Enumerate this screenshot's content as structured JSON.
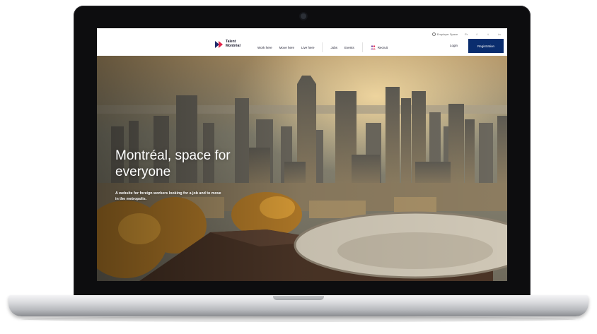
{
  "utility": {
    "employer_space": "Employer Space",
    "language": "Fr",
    "social_icons": [
      "facebook-icon",
      "twitter-icon",
      "linkedin-icon"
    ]
  },
  "brand": {
    "line1": "Talent",
    "line2": "Montréal",
    "colors": {
      "mark_dark": "#1d2a6b",
      "mark_accent": "#e2254a",
      "nav_button": "#0a2d6e"
    }
  },
  "nav": {
    "work_here": "Work here",
    "move_here": "Move here",
    "live_here": "Live here",
    "jobs": "Jobs",
    "events": "Events",
    "recruit": "Recruit",
    "login": "Login",
    "registration": "Registration"
  },
  "hero": {
    "title": "Montréal, space for everyone",
    "subtitle": "A website for foreign workers looking for a job and to move in the metropolis."
  }
}
